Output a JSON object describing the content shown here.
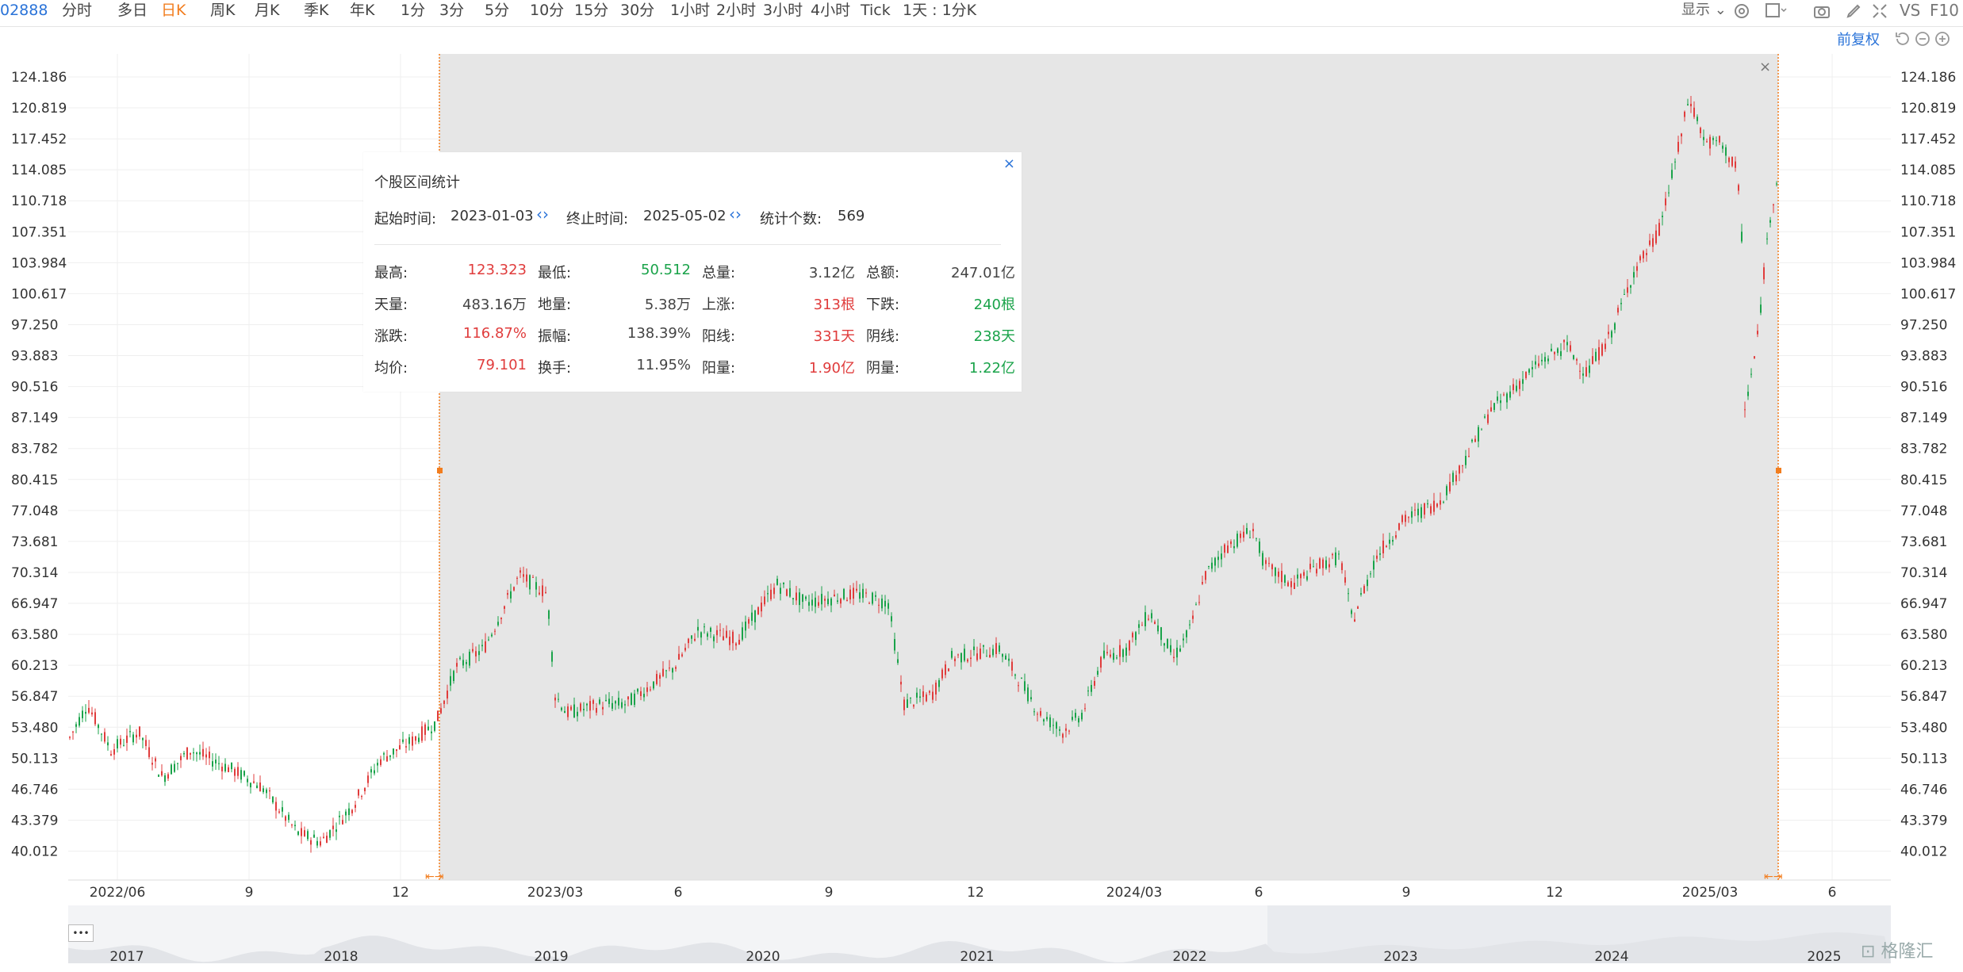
{
  "toolbar": {
    "code": "02888",
    "periods": [
      "分时",
      "多日",
      "日K",
      "周K",
      "月K",
      "季K",
      "年K",
      "1分",
      "3分",
      "5分",
      "10分",
      "15分",
      "30分",
      "1小时",
      "2小时",
      "3小时",
      "4小时",
      "Tick",
      "1天 : 1分K"
    ],
    "active_period": "日K",
    "display_label": "显示",
    "vs_label": "VS",
    "f10_label": "F10",
    "adjust_label": "前复权"
  },
  "chart": {
    "y_ticks": [
      "124.186",
      "120.819",
      "117.452",
      "114.085",
      "110.718",
      "107.351",
      "103.984",
      "100.617",
      "97.250",
      "93.883",
      "90.516",
      "87.149",
      "83.782",
      "80.415",
      "77.048",
      "73.681",
      "70.314",
      "66.947",
      "63.580",
      "60.213",
      "56.847",
      "53.480",
      "50.113",
      "46.746",
      "43.379",
      "40.012"
    ],
    "x_ticks": [
      "2022/06",
      "9",
      "12",
      "2023/03",
      "6",
      "9",
      "12",
      "2024/03",
      "6",
      "9",
      "12",
      "2025/03",
      "6"
    ],
    "overview_years": [
      "2017",
      "2018",
      "2019",
      "2020",
      "2021",
      "2022",
      "2023",
      "2024",
      "2025"
    ],
    "selection_close": "×",
    "colors": {
      "up": "#e03c3c",
      "down": "#1aa34a",
      "selection": "#e6e6e6",
      "marker": "#f27d1e"
    }
  },
  "stats": {
    "title": "个股区间统计",
    "close": "×",
    "start_label": "起始时间:",
    "start_value": "2023-01-03",
    "end_label": "终止时间:",
    "end_value": "2025-05-02",
    "count_label": "统计个数:",
    "count_value": "569",
    "rows": [
      [
        {
          "l": "最高:",
          "v": "123.323",
          "c": "red"
        },
        {
          "l": "最低:",
          "v": "50.512",
          "c": "green"
        },
        {
          "l": "总量:",
          "v": "3.12亿",
          "c": "gray"
        },
        {
          "l": "总额:",
          "v": "247.01亿",
          "c": "gray"
        }
      ],
      [
        {
          "l": "天量:",
          "v": "483.16万",
          "c": "gray"
        },
        {
          "l": "地量:",
          "v": "5.38万",
          "c": "gray"
        },
        {
          "l": "上涨:",
          "v": "313根",
          "c": "red"
        },
        {
          "l": "下跌:",
          "v": "240根",
          "c": "green"
        }
      ],
      [
        {
          "l": "涨跌:",
          "v": "116.87%",
          "c": "red"
        },
        {
          "l": "振幅:",
          "v": "138.39%",
          "c": "gray"
        },
        {
          "l": "阳线:",
          "v": "331天",
          "c": "red"
        },
        {
          "l": "阴线:",
          "v": "238天",
          "c": "green"
        }
      ],
      [
        {
          "l": "均价:",
          "v": "79.101",
          "c": "red"
        },
        {
          "l": "换手:",
          "v": "11.95%",
          "c": "gray"
        },
        {
          "l": "阳量:",
          "v": "1.90亿",
          "c": "red"
        },
        {
          "l": "阴量:",
          "v": "1.22亿",
          "c": "green"
        }
      ]
    ]
  },
  "overview": {
    "menu": "•••",
    "brand": "格隆汇"
  }
}
